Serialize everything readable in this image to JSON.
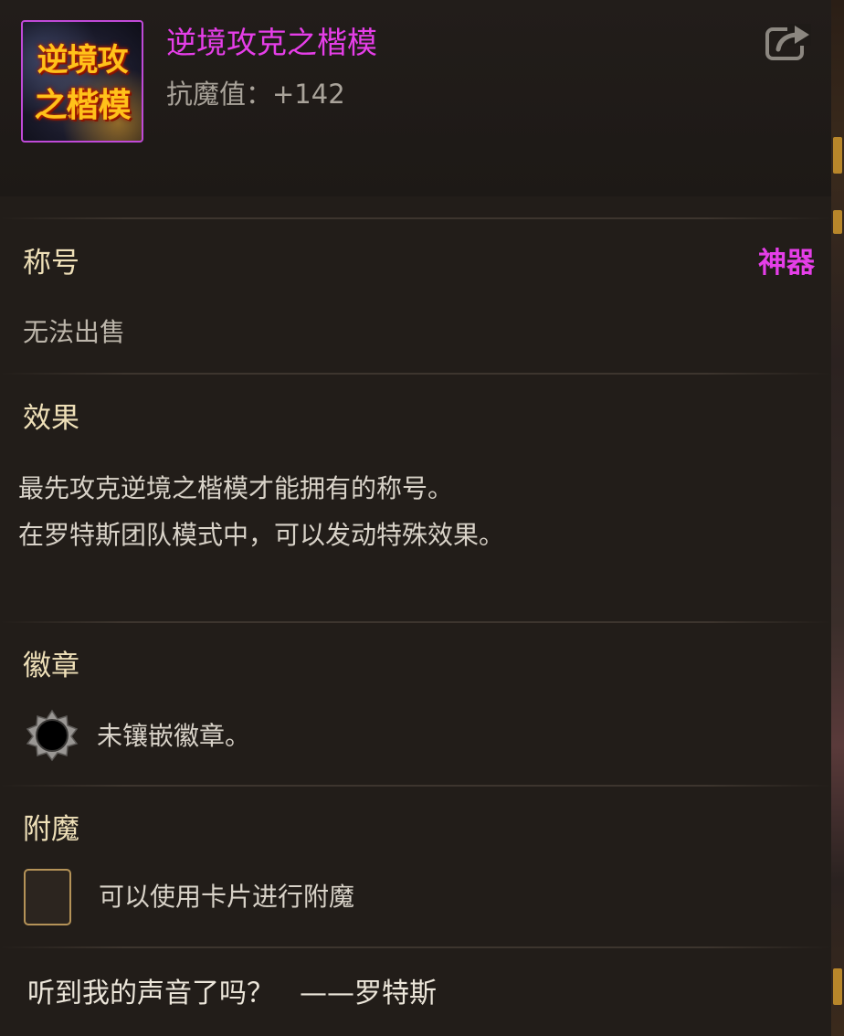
{
  "item": {
    "icon_name": "title-emblem-icon",
    "icon_text_line1": "逆境攻克",
    "icon_text_line2": "之楷模",
    "name": "逆境攻克之楷模",
    "stat": "抗魔值：+142",
    "share_icon": "share-export-icon"
  },
  "category": {
    "label": "称号",
    "rarity": "神器",
    "trade_status": "无法出售"
  },
  "effect": {
    "label": "效果",
    "lines": [
      "最先攻克逆境之楷模才能拥有的称号。",
      "在罗特斯团队模式中，可以发动特殊效果。"
    ]
  },
  "emblem": {
    "label": "徽章",
    "icon_name": "empty-emblem-socket-icon",
    "text": "未镶嵌徽章。"
  },
  "enchant": {
    "label": "附魔",
    "icon_name": "card-slot-icon",
    "text": "可以使用卡片进行附魔"
  },
  "flavor": {
    "quote": "听到我的声音了吗？",
    "author": "——罗特斯"
  },
  "colors": {
    "rarity_magenta": "#e53ee8",
    "section_heading": "#efe0b8",
    "body_text": "#d8d2c8",
    "panel_bg": "#221d19",
    "slot_border": "#b59358"
  }
}
